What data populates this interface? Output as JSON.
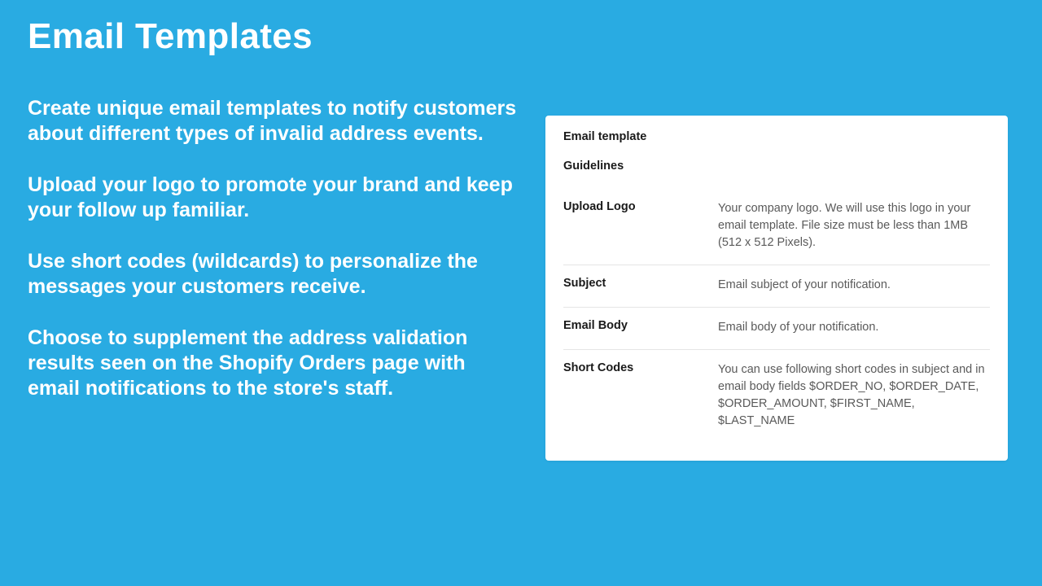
{
  "title": "Email Templates",
  "paragraphs": {
    "p1": "Create unique email templates to notify customers about different types of invalid address events.",
    "p2": "Upload your logo to promote your brand and keep your follow up familiar.",
    "p3": "Use short codes (wildcards) to personalize the messages your customers receive.",
    "p4": "Choose to supplement the address validation results seen on the Shopify Orders page with email notifications to the store's staff."
  },
  "card": {
    "title": "Email template",
    "subtitle": "Guidelines",
    "rows": [
      {
        "label": "Upload Logo",
        "desc": "Your company logo. We will use this logo in your email template. File size must be less than 1MB (512 x 512 Pixels)."
      },
      {
        "label": "Subject",
        "desc": "Email subject of your notification."
      },
      {
        "label": "Email Body",
        "desc": "Email body of your notification."
      },
      {
        "label": "Short Codes",
        "desc": "You can use following short codes in subject and in email body fields $ORDER_NO, $ORDER_DATE, $ORDER_AMOUNT, $FIRST_NAME, $LAST_NAME"
      }
    ]
  }
}
